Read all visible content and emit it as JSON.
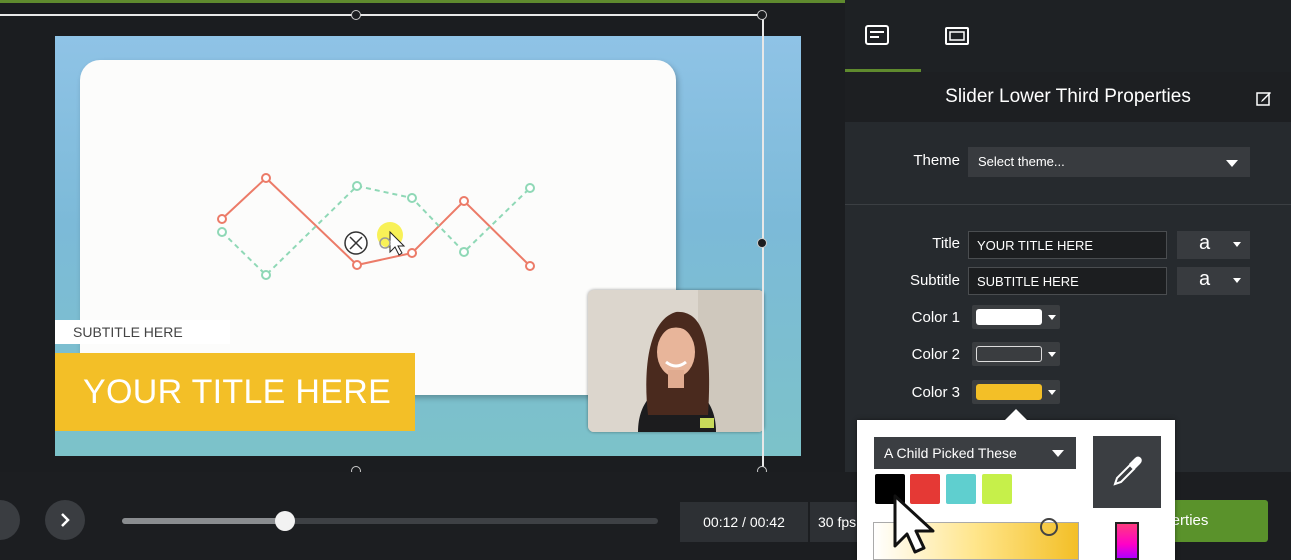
{
  "canvas": {
    "subtitle_text": "SUBTITLE HERE",
    "title_text": "YOUR TITLE HERE"
  },
  "panel": {
    "tabs": [
      {
        "name": "properties-tab",
        "icon": "text-properties-icon"
      },
      {
        "name": "visual-tab",
        "icon": "filmstrip-icon"
      }
    ],
    "header": "Slider Lower Third Properties",
    "theme": {
      "label": "Theme",
      "value": "Select theme..."
    },
    "title": {
      "label": "Title",
      "value": "YOUR TITLE HERE",
      "font_glyph": "a"
    },
    "subtitle": {
      "label": "Subtitle",
      "value": "SUBTITLE HERE",
      "font_glyph": "a"
    },
    "colors": [
      {
        "label": "Color 1",
        "value": "#ffffff"
      },
      {
        "label": "Color 2",
        "value": "#3a3d40"
      },
      {
        "label": "Color 3",
        "value": "#f3bf27"
      }
    ]
  },
  "color_popup": {
    "palette_name": "A Child Picked These",
    "palette": [
      "#000000",
      "#e53935",
      "#5fcfcf",
      "#c6f04a"
    ]
  },
  "playback": {
    "time": "00:12 / 00:42",
    "fps": "30 fps",
    "progress": 0.305,
    "properties_button": "Properties"
  }
}
